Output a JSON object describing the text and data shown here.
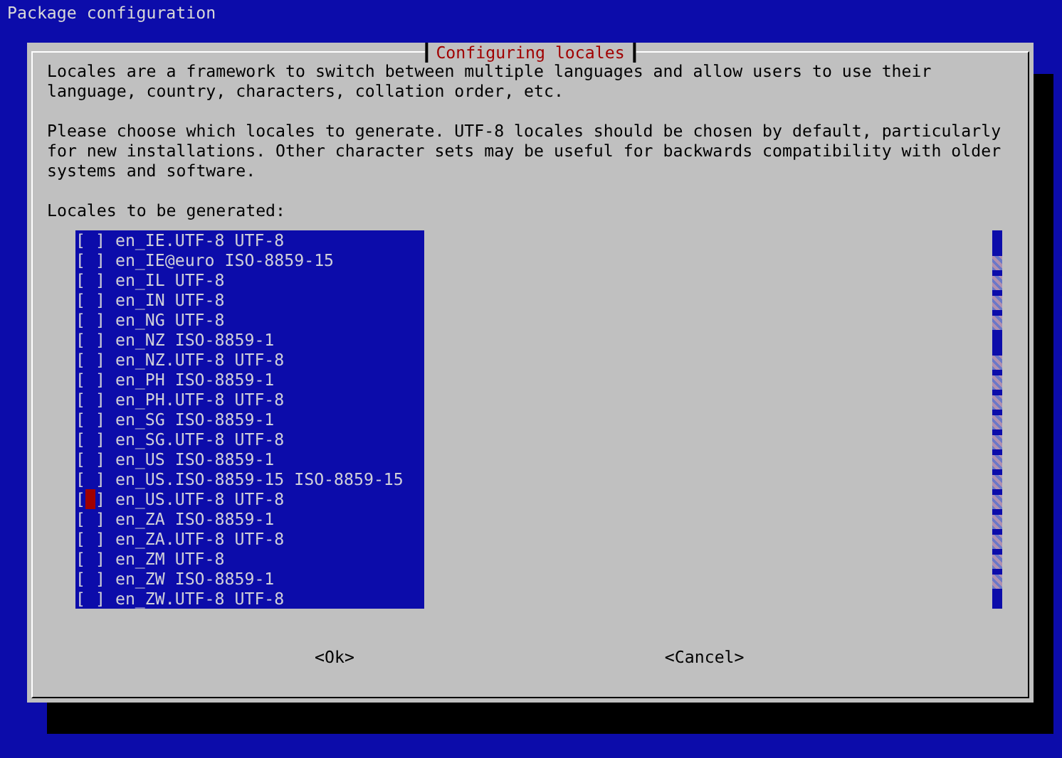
{
  "window": {
    "title": "Package configuration"
  },
  "dialog": {
    "title": "Configuring locales",
    "paragraphs": [
      "Locales are a framework to switch between multiple languages and allow users to use their language, country, characters, collation order, etc.",
      "Please choose which locales to generate. UTF-8 locales should be chosen by default, particularly for new installations. Other character sets may be useful for backwards compatibility with older systems and software."
    ],
    "list_label": "Locales to be generated:",
    "checkbox_open": "[",
    "checkbox_close": "]",
    "items": [
      {
        "label": "en_IE.UTF-8 UTF-8",
        "checked": false,
        "focused": false
      },
      {
        "label": "en_IE@euro ISO-8859-15",
        "checked": false,
        "focused": false
      },
      {
        "label": "en_IL UTF-8",
        "checked": false,
        "focused": false
      },
      {
        "label": "en_IN UTF-8",
        "checked": false,
        "focused": false
      },
      {
        "label": "en_NG UTF-8",
        "checked": false,
        "focused": false
      },
      {
        "label": "en_NZ ISO-8859-1",
        "checked": false,
        "focused": false
      },
      {
        "label": "en_NZ.UTF-8 UTF-8",
        "checked": false,
        "focused": false
      },
      {
        "label": "en_PH ISO-8859-1",
        "checked": false,
        "focused": false
      },
      {
        "label": "en_PH.UTF-8 UTF-8",
        "checked": false,
        "focused": false
      },
      {
        "label": "en_SG ISO-8859-1",
        "checked": false,
        "focused": false
      },
      {
        "label": "en_SG.UTF-8 UTF-8",
        "checked": false,
        "focused": false
      },
      {
        "label": "en_US ISO-8859-1",
        "checked": false,
        "focused": false
      },
      {
        "label": "en_US.ISO-8859-15 ISO-8859-15",
        "checked": false,
        "focused": false
      },
      {
        "label": "en_US.UTF-8 UTF-8",
        "checked": false,
        "focused": true
      },
      {
        "label": "en_ZA ISO-8859-1",
        "checked": false,
        "focused": false
      },
      {
        "label": "en_ZA.UTF-8 UTF-8",
        "checked": false,
        "focused": false
      },
      {
        "label": "en_ZM UTF-8",
        "checked": false,
        "focused": false
      },
      {
        "label": "en_ZW ISO-8859-1",
        "checked": false,
        "focused": false
      },
      {
        "label": "en_ZW.UTF-8 UTF-8",
        "checked": false,
        "focused": false
      }
    ],
    "buttons": [
      "<Ok>",
      "<Cancel>"
    ]
  }
}
